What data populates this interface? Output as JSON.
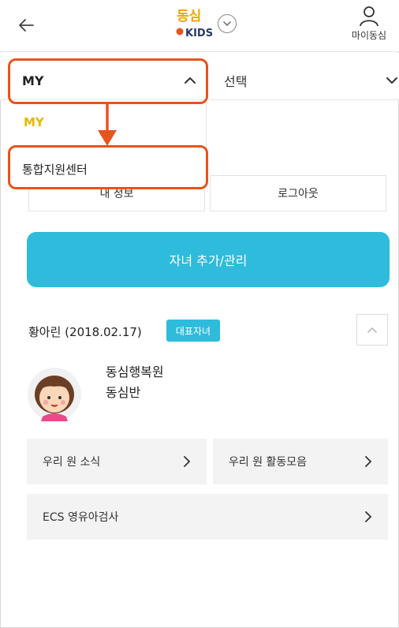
{
  "header": {
    "logo_text_top": "동심",
    "logo_text_bottom": "KIDS",
    "user_label": "마이동심"
  },
  "selector": {
    "left_value": "MY",
    "right_value": "선택"
  },
  "dropdown": {
    "options": [
      "MY",
      "통합지원센터"
    ]
  },
  "account": {
    "my_info_label": "내 정보",
    "logout_label": "로그아웃"
  },
  "cta_label": "자녀 추가/관리",
  "child": {
    "name": "황아린 (2018.02.17)",
    "badge": "대표자녀",
    "kindergarten": "동심행복원",
    "class": "동심반"
  },
  "menu": {
    "news": "우리 원 소식",
    "activity": "우리 원 활동모음",
    "ecs": "ECS 영유아검사"
  },
  "colors": {
    "accent": "#2fbbdb",
    "highlight": "#e8541c",
    "selected_option": "#e6b800"
  },
  "icons": [
    "back-arrow-icon",
    "chevron-down-icon",
    "user-icon",
    "chevron-up-icon",
    "chevron-right-icon",
    "avatar-girl"
  ]
}
